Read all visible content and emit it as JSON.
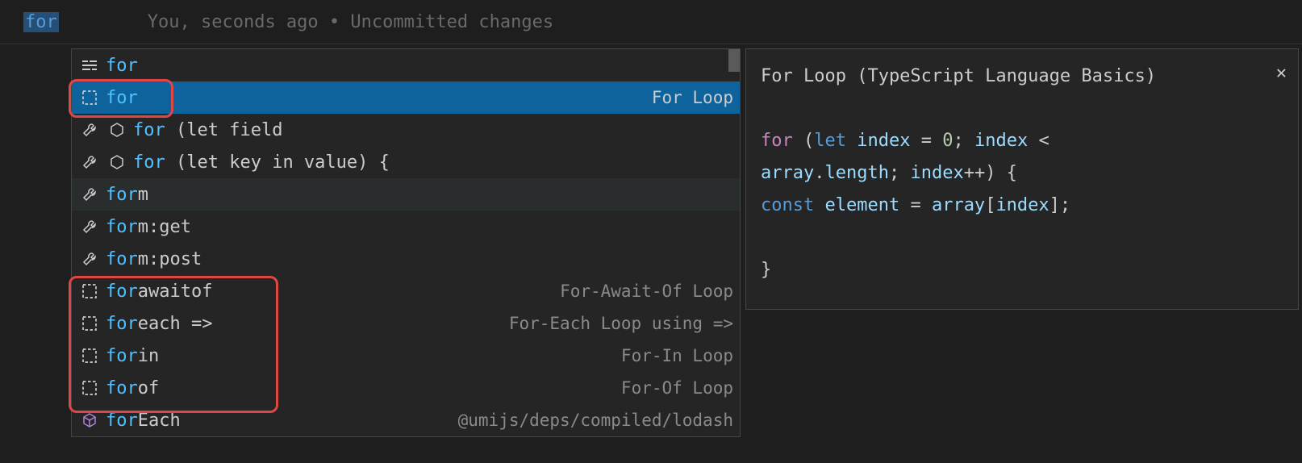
{
  "editor": {
    "typed": "for",
    "codelens": "You, seconds ago • Uncommitted changes"
  },
  "suggestions": [
    {
      "icon": "keyword",
      "match": "for",
      "rest": "",
      "detail": ""
    },
    {
      "icon": "snippet",
      "match": "for",
      "rest": "",
      "detail": "For Loop",
      "selected": true
    },
    {
      "icon": "wrench-hex",
      "match": "for",
      "rest": " (let field",
      "detail": ""
    },
    {
      "icon": "wrench-hex",
      "match": "for",
      "rest": " (let key in value) {",
      "detail": ""
    },
    {
      "icon": "wrench",
      "match": "for",
      "rest": "m",
      "detail": "",
      "hover": true
    },
    {
      "icon": "wrench",
      "match": "for",
      "rest": "m:get",
      "detail": ""
    },
    {
      "icon": "wrench",
      "match": "for",
      "rest": "m:post",
      "detail": ""
    },
    {
      "icon": "snippet",
      "match": "for",
      "rest": "awaitof",
      "detail": "For-Await-Of Loop"
    },
    {
      "icon": "snippet",
      "match": "for",
      "rest": "each =>",
      "detail": "For-Each Loop using =>"
    },
    {
      "icon": "snippet",
      "match": "for",
      "rest": "in",
      "detail": "For-In Loop"
    },
    {
      "icon": "snippet",
      "match": "for",
      "rest": "of",
      "detail": "For-Of Loop"
    },
    {
      "icon": "cube",
      "match": "for",
      "rest": "Each",
      "detail": "@umijs/deps/compiled/lodash"
    }
  ],
  "details": {
    "title": "For Loop (TypeScript Language Basics)",
    "code_plain": "for (let index = 0; index < array.length; index++) {\nconst element = array[index];\n\n}",
    "tokens": [
      [
        {
          "t": "for",
          "c": "tk-keyword"
        },
        {
          "t": " (",
          "c": "tk-punct"
        },
        {
          "t": "let",
          "c": "tk-keyword2"
        },
        {
          "t": " ",
          "c": "tk-punct"
        },
        {
          "t": "index",
          "c": "tk-var"
        },
        {
          "t": " = ",
          "c": "tk-punct"
        },
        {
          "t": "0",
          "c": "tk-num"
        },
        {
          "t": "; ",
          "c": "tk-punct"
        },
        {
          "t": "index",
          "c": "tk-var"
        },
        {
          "t": " < ",
          "c": "tk-punct"
        }
      ],
      [
        {
          "t": "array",
          "c": "tk-var"
        },
        {
          "t": ".",
          "c": "tk-punct"
        },
        {
          "t": "length",
          "c": "tk-var"
        },
        {
          "t": "; ",
          "c": "tk-punct"
        },
        {
          "t": "index",
          "c": "tk-var"
        },
        {
          "t": "++) {",
          "c": "tk-punct"
        }
      ],
      [
        {
          "t": "const",
          "c": "tk-keyword2"
        },
        {
          "t": " ",
          "c": "tk-punct"
        },
        {
          "t": "element",
          "c": "tk-var"
        },
        {
          "t": " = ",
          "c": "tk-punct"
        },
        {
          "t": "array",
          "c": "tk-var"
        },
        {
          "t": "[",
          "c": "tk-punct"
        },
        {
          "t": "index",
          "c": "tk-var"
        },
        {
          "t": "];",
          "c": "tk-punct"
        }
      ],
      [],
      [
        {
          "t": "}",
          "c": "tk-punct"
        }
      ]
    ]
  }
}
